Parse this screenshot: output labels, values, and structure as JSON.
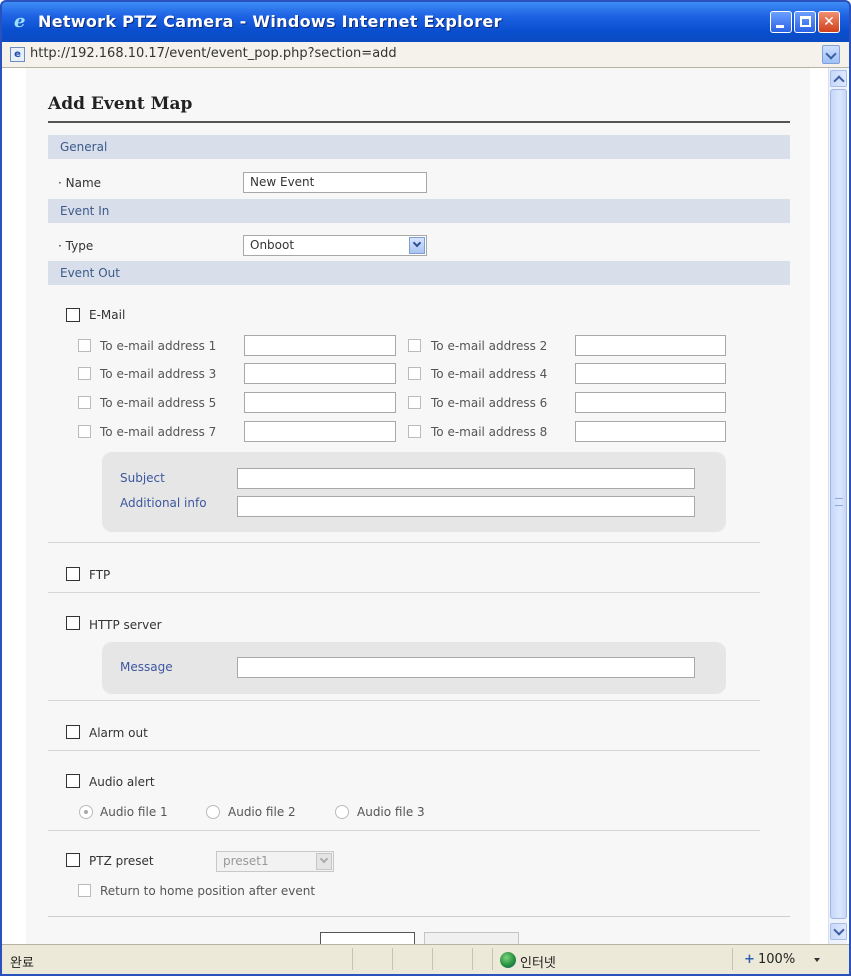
{
  "window": {
    "title": "Network PTZ Camera - Windows Internet Explorer",
    "url": "http://192.168.10.17/event/event_pop.php?section=add",
    "status_text": "완료",
    "zone_text": "인터넷",
    "zoom_text": "100%"
  },
  "page": {
    "title": "Add Event Map"
  },
  "general": {
    "header": "General",
    "name_label": "Name",
    "name_value": "New Event"
  },
  "event_in": {
    "header": "Event In",
    "type_label": "Type",
    "type_value": "Onboot"
  },
  "event_out": {
    "header": "Event Out",
    "email": {
      "label": "E-Mail",
      "addresses": [
        "To e-mail address 1",
        "To e-mail address 2",
        "To e-mail address 3",
        "To e-mail address 4",
        "To e-mail address 5",
        "To e-mail address 6",
        "To e-mail address 7",
        "To e-mail address 8"
      ],
      "subject_label": "Subject",
      "additional_label": "Additional info"
    },
    "ftp_label": "FTP",
    "http": {
      "label": "HTTP server",
      "message_label": "Message"
    },
    "alarm_label": "Alarm out",
    "audio": {
      "label": "Audio alert",
      "files": [
        "Audio file 1",
        "Audio file 2",
        "Audio file 3"
      ]
    },
    "ptz": {
      "label": "PTZ preset",
      "preset_value": "preset1",
      "return_label": "Return to home position after event"
    }
  },
  "colors": {
    "titlebar": "#0a4fd0",
    "section_bar": "#d8dfea",
    "section_text": "#3c5a8a",
    "panel": "#e6e6e6",
    "panel_label": "#3d57a0"
  }
}
